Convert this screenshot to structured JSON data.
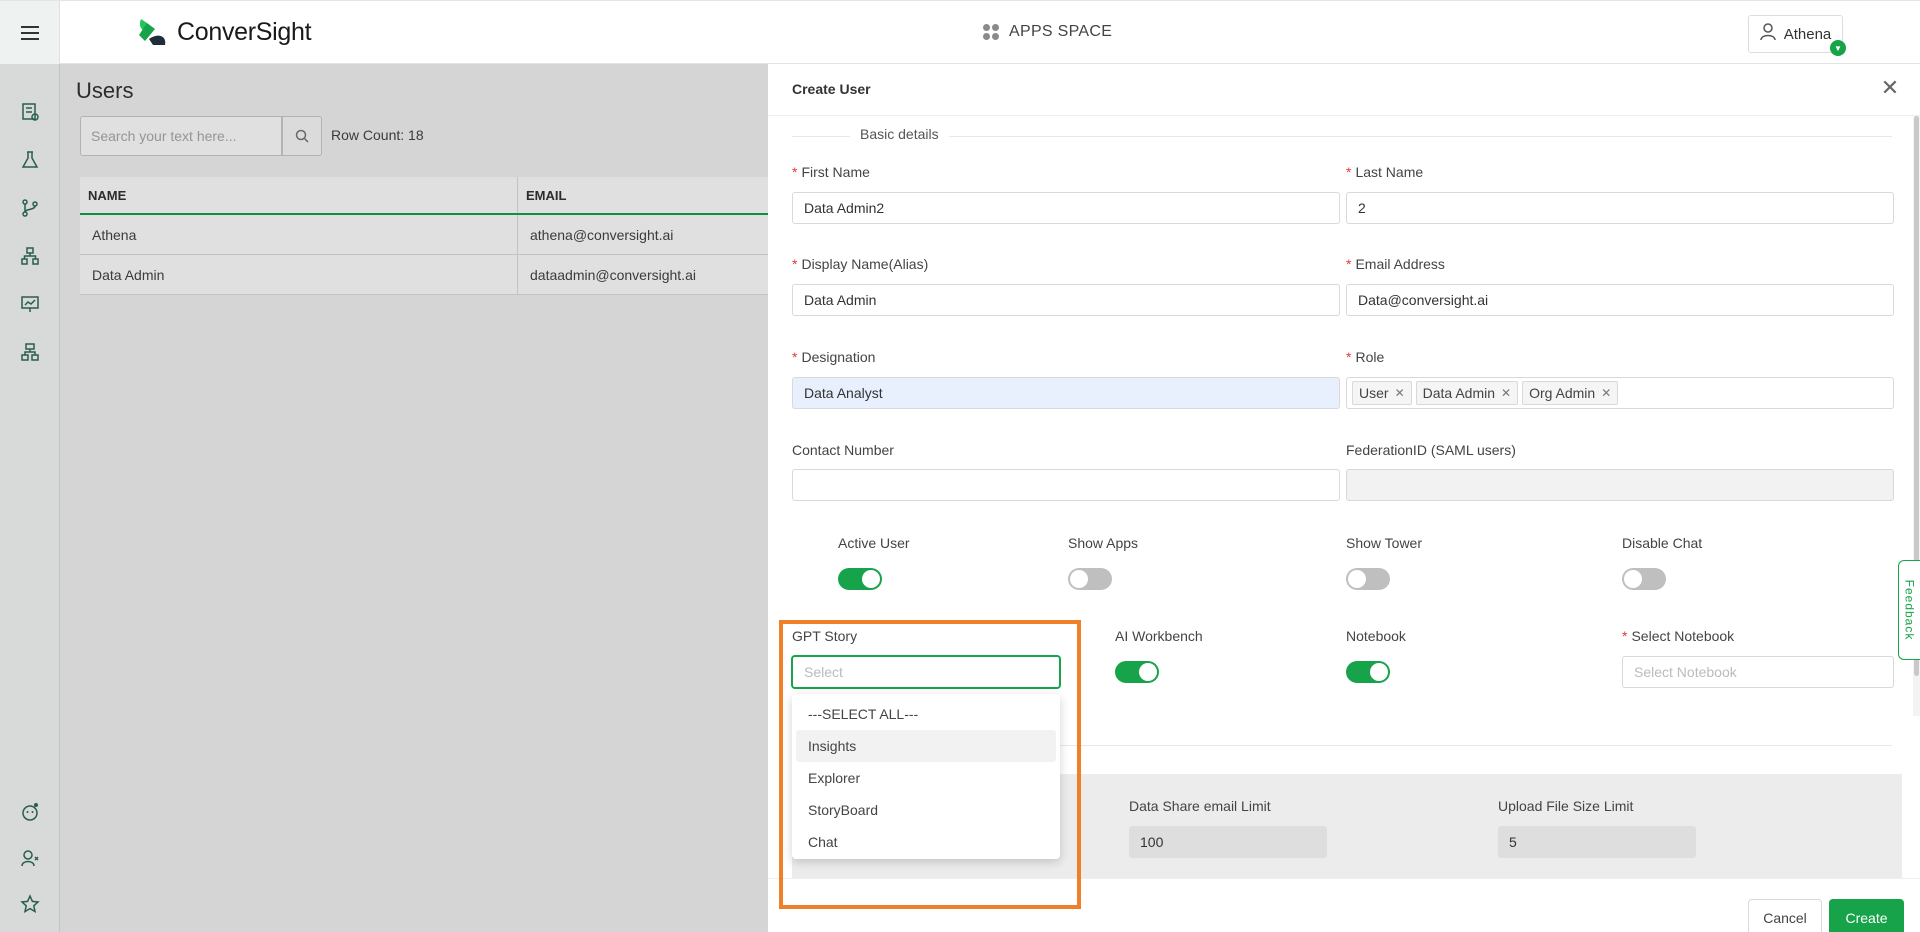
{
  "app": {
    "name": "ConverSight",
    "apps_space": "APPS SPACE",
    "user_name": "Athena"
  },
  "users": {
    "title": "Users",
    "search_placeholder": "Search your text here...",
    "row_count": "Row Count: 18",
    "columns": [
      "NAME",
      "EMAIL"
    ],
    "rows": [
      {
        "name": "Athena",
        "email": "athena@conversight.ai"
      },
      {
        "name": "Data Admin",
        "email": "dataadmin@conversight.ai"
      }
    ]
  },
  "drawer": {
    "title": "Create User",
    "section": "Basic details",
    "fields": {
      "first_name": {
        "label": "First Name",
        "value": "Data Admin2"
      },
      "last_name": {
        "label": "Last Name",
        "value": "2"
      },
      "display_name": {
        "label": "Display Name(Alias)",
        "value": "Data Admin"
      },
      "email": {
        "label": "Email Address",
        "value": "Data@conversight.ai"
      },
      "designation": {
        "label": "Designation",
        "value": "Data Analyst"
      },
      "role": {
        "label": "Role",
        "tags": [
          "User",
          "Data Admin",
          "Org Admin"
        ]
      },
      "contact": {
        "label": "Contact Number",
        "value": ""
      },
      "federation": {
        "label": "FederationID (SAML users)",
        "value": ""
      }
    },
    "toggles": [
      {
        "label": "Active User",
        "on": true
      },
      {
        "label": "Show Apps",
        "on": false
      },
      {
        "label": "Show Tower",
        "on": false
      },
      {
        "label": "Disable Chat",
        "on": false
      },
      {
        "label": "AI Workbench",
        "on": true
      },
      {
        "label": "Notebook",
        "on": true
      }
    ],
    "gpt_story": {
      "label": "GPT Story",
      "placeholder": "Select",
      "options": [
        "---SELECT ALL---",
        "Insights",
        "Explorer",
        "StoryBoard",
        "Chat"
      ],
      "hovered": "Insights"
    },
    "select_notebook": {
      "label": "Select Notebook",
      "placeholder": "Select Notebook"
    },
    "limits": {
      "data_share": {
        "label": "Data Share email Limit",
        "value": "100"
      },
      "upload_size": {
        "label": "Upload File Size Limit",
        "value": "5"
      }
    },
    "cancel_label": "Cancel",
    "create_label": "Create"
  },
  "feedback_label": "Feedback",
  "colors": {
    "brand": "#16a34a",
    "highlight": "#f07f2a",
    "required": "#e53935"
  }
}
